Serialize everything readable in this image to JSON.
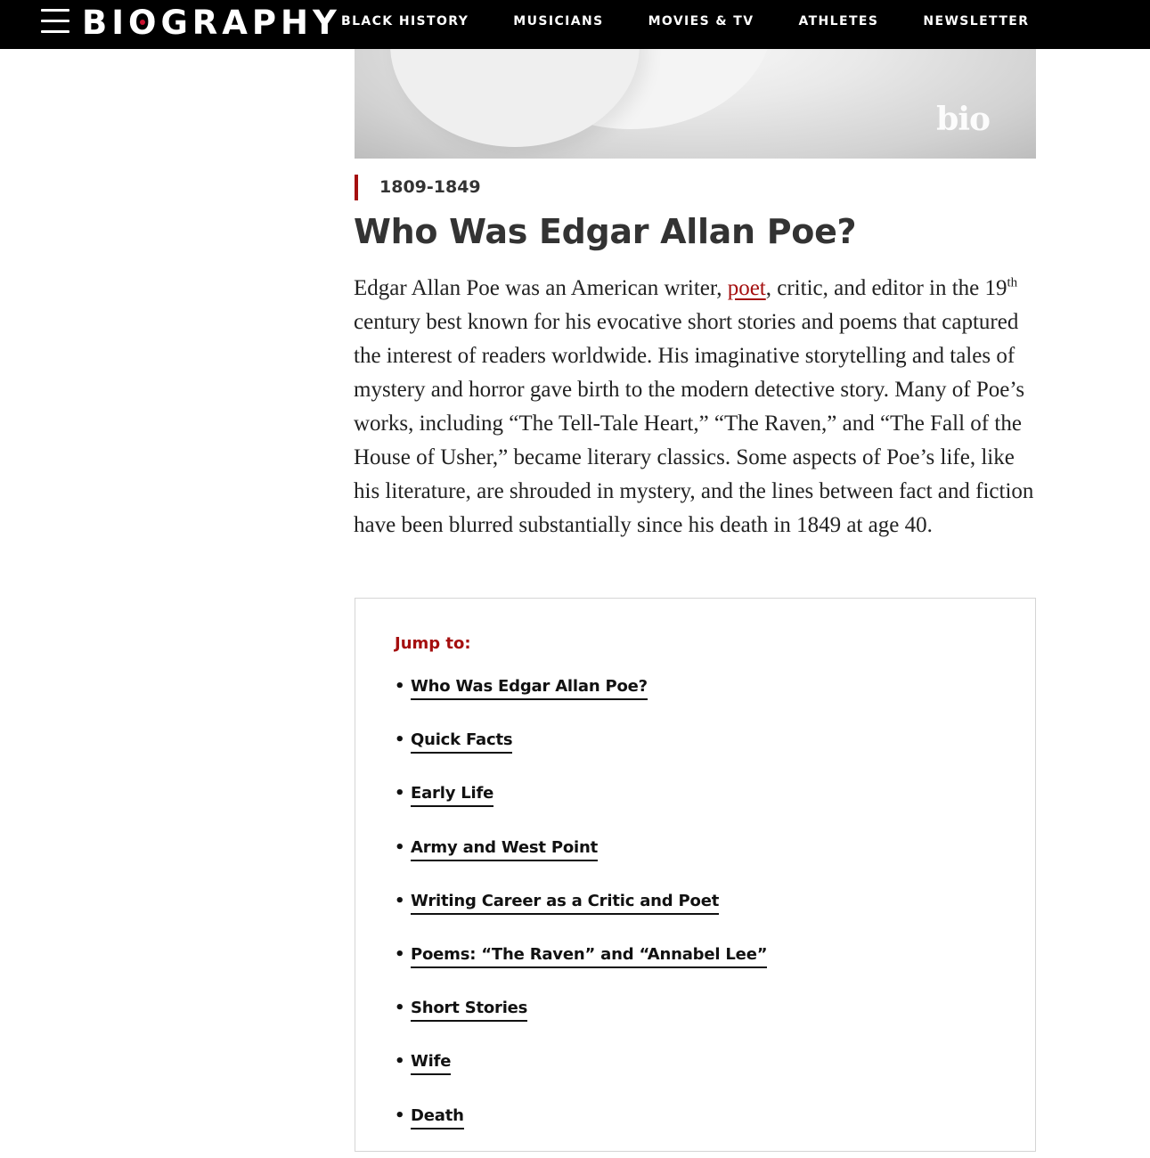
{
  "header": {
    "logo_text": "BIOGRAPHY",
    "menu_icon": "hamburger-menu-icon",
    "nav": [
      {
        "label": "BLACK HISTORY"
      },
      {
        "label": "MUSICIANS"
      },
      {
        "label": "MOVIES & TV"
      },
      {
        "label": "ATHLETES"
      },
      {
        "label": "NEWSLETTER"
      }
    ]
  },
  "hero": {
    "watermark": "bio"
  },
  "article": {
    "dates": "1809-1849",
    "title": "Who Was Edgar Allan Poe?",
    "intro": {
      "part1": "Edgar Allan Poe was an American writer, ",
      "link": "poet",
      "part2": ", critic, and editor in the 19",
      "sup": "th",
      "part3": " century best known for his evocative short stories and poems that captured the interest of readers worldwide. His imaginative storytelling and tales of mystery and horror gave birth to the modern detective story. Many of Poe’s works, including “The Tell-Tale Heart,” “The Raven,” and “The Fall of the House of Usher,” became literary classics. Some aspects of Poe’s life, like his literature, are shrouded in mystery, and the lines between fact and fiction have been blurred substantially since his death in 1849 at age 40."
    }
  },
  "jump_to": {
    "label": "Jump to:",
    "bullet": "•",
    "items": [
      "Who Was Edgar Allan Poe?",
      "Quick Facts",
      "Early Life",
      "Army and West Point",
      "Writing Career as a Critic and Poet",
      "Poems: “The Raven” and “Annabel Lee”",
      "Short Stories",
      "Wife",
      "Death"
    ]
  },
  "colors": {
    "brand_red": "#a50f0f",
    "logo_dot": "#c8102e",
    "header_bg": "#000000"
  }
}
